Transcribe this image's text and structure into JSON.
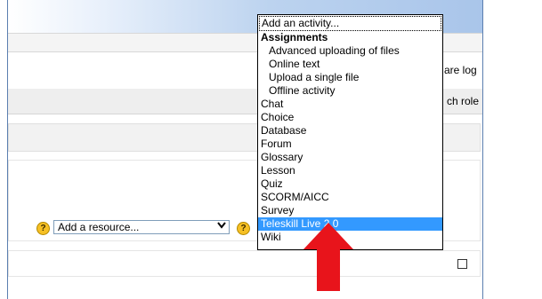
{
  "header": {
    "right_text_1": "are log",
    "right_text_2": "ch role"
  },
  "resource_select": {
    "value": "Add a resource...",
    "help_label": "?"
  },
  "activity_help_label": "?",
  "activity_dropdown": {
    "items": [
      {
        "label": "Add an activity...",
        "kind": "first"
      },
      {
        "label": "Assignments",
        "kind": "group"
      },
      {
        "label": "Advanced uploading of files",
        "kind": "sub"
      },
      {
        "label": "Online text",
        "kind": "sub"
      },
      {
        "label": "Upload a single file",
        "kind": "sub"
      },
      {
        "label": "Offline activity",
        "kind": "sub"
      },
      {
        "label": "Chat",
        "kind": "item"
      },
      {
        "label": "Choice",
        "kind": "item"
      },
      {
        "label": "Database",
        "kind": "item"
      },
      {
        "label": "Forum",
        "kind": "item"
      },
      {
        "label": "Glossary",
        "kind": "item"
      },
      {
        "label": "Lesson",
        "kind": "item"
      },
      {
        "label": "Quiz",
        "kind": "item"
      },
      {
        "label": "SCORM/AICC",
        "kind": "item"
      },
      {
        "label": "Survey",
        "kind": "item"
      },
      {
        "label": "Teleskill Live 2.0",
        "kind": "selected"
      },
      {
        "label": "Wiki",
        "kind": "item"
      }
    ]
  },
  "colors": {
    "highlight": "#3399ff",
    "annotation_arrow": "#e8141b"
  },
  "icons": {
    "help": "question-circle-icon",
    "dropdown_arrow": "chevron-down-icon",
    "annotation": "red-arrow-up-icon"
  }
}
